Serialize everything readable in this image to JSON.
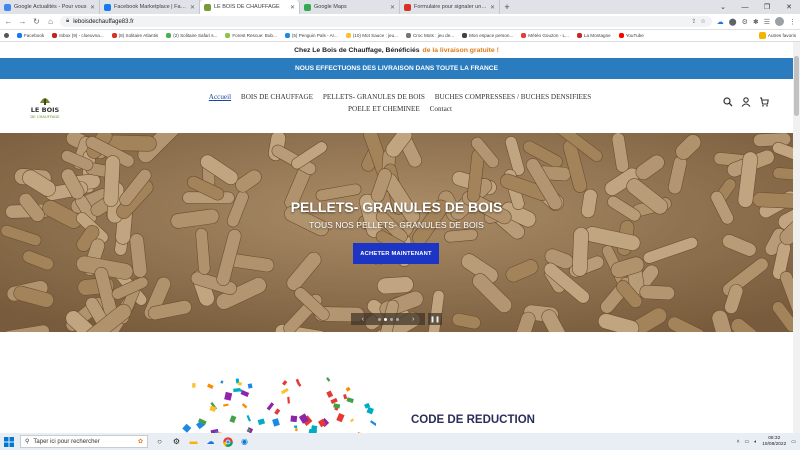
{
  "browser": {
    "tabs": [
      {
        "title": "Google Actualités - Pour vous",
        "color": "#4285f4"
      },
      {
        "title": "Facebook Marketplace | Facebook",
        "color": "#1877f2"
      },
      {
        "title": "LE BOIS DE CHAUFFAGE",
        "color": "#7a9a3a"
      },
      {
        "title": "Google Maps",
        "color": "#34a853"
      },
      {
        "title": "Formulaire pour signaler une arnaque",
        "color": "#d93025"
      }
    ],
    "active_tab": 2,
    "url": "leboisdechauffage83.fr",
    "bookmarks": [
      {
        "label": "Facebook",
        "color": "#1877f2"
      },
      {
        "label": "Inbox (9) - cloeuvna...",
        "color": "#c5221f"
      },
      {
        "label": "(8) Solitaire Atlantis",
        "color": "#d93025"
      },
      {
        "label": "(2) Solitaire Safari s...",
        "color": "#4caf50"
      },
      {
        "label": "Forest Rescue: Bub...",
        "color": "#8bc34a"
      },
      {
        "label": "(5) Penguin Pals - Ar...",
        "color": "#1e88e5"
      },
      {
        "label": "(10) Mot Sauce : jeu...",
        "color": "#fbc02d"
      },
      {
        "label": "Croc Mots : jeu de...",
        "color": "#757575"
      },
      {
        "label": "Mon espace person...",
        "color": "#424242"
      },
      {
        "label": "Météo Gouzon - L...",
        "color": "#e53935"
      },
      {
        "label": "La Montagne",
        "color": "#c62828"
      },
      {
        "label": "YouTube",
        "color": "#ff0000"
      }
    ],
    "other_bookmarks": "Autres favoris"
  },
  "site": {
    "promo_bar": {
      "text": "Chez Le Bois de Chauffage, Bénéficiés",
      "highlight": "de la livraison gratuite !"
    },
    "announcement": "NOUS EFFECTUONS DES LIVRAISON DANS TOUTE LA FRANCE",
    "logo": {
      "line1": "LE BOIS",
      "line2": "DE CHAUFFAGE"
    },
    "menu": [
      "Accueil",
      "BOIS DE CHAUFFAGE",
      "PELLETS- GRANULES DE BOIS",
      "BUCHES COMPRESSEES / BUCHES DENSIFIEES",
      "POELE ET CHEMINEE",
      "Contact"
    ],
    "hero": {
      "title": "PELLETS- GRANULES DE BOIS",
      "subtitle": "TOUS NOS PELLETS- GRANULES DE BOIS",
      "button": "ACHETER MAINTENANT",
      "slides": 4,
      "current_slide": 2
    },
    "promo_section_title": "CODE DE REDUCTION"
  },
  "taskbar": {
    "search_placeholder": "Taper ici pour rechercher",
    "time": "08:32",
    "date": "19/08/2022"
  },
  "colors": {
    "accent_blue": "#2b7bbf",
    "button_blue": "#1d35c4",
    "highlight_orange": "#e07b1a"
  }
}
